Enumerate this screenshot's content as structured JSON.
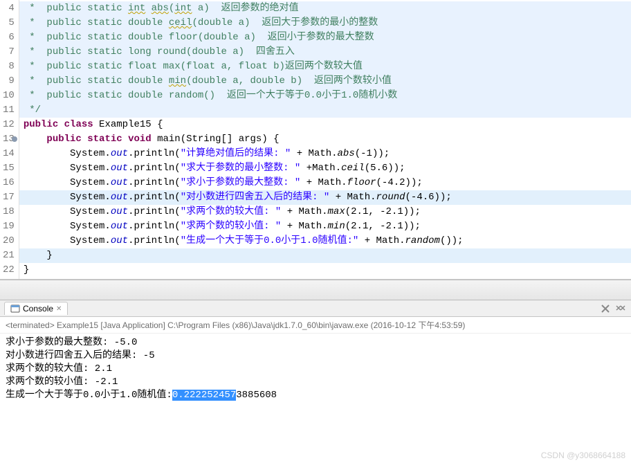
{
  "editor": {
    "lines": [
      {
        "num": "4",
        "bg": "comment-block",
        "seg": [
          {
            "t": " *  ",
            "c": "comment"
          },
          {
            "t": "public static ",
            "c": "comment"
          },
          {
            "t": "int",
            "c": "comment wavy"
          },
          {
            "t": " ",
            "c": "comment"
          },
          {
            "t": "abs",
            "c": "comment wavy"
          },
          {
            "t": "(",
            "c": "comment"
          },
          {
            "t": "int",
            "c": "comment wavy"
          },
          {
            "t": " a)  返回参数的绝对值",
            "c": "comment"
          }
        ]
      },
      {
        "num": "5",
        "bg": "comment-block",
        "seg": [
          {
            "t": " *  ",
            "c": "comment"
          },
          {
            "t": "public static double ",
            "c": "comment"
          },
          {
            "t": "ceil",
            "c": "comment wavy"
          },
          {
            "t": "(double a)  返回大于参数的最小的整数",
            "c": "comment"
          }
        ]
      },
      {
        "num": "6",
        "bg": "comment-block",
        "seg": [
          {
            "t": " *  public static double floor(double a)  返回小于参数的最大整数",
            "c": "comment"
          }
        ]
      },
      {
        "num": "7",
        "bg": "comment-block",
        "seg": [
          {
            "t": " *  public static long round(double a)  四舍五入",
            "c": "comment"
          }
        ]
      },
      {
        "num": "8",
        "bg": "comment-block",
        "seg": [
          {
            "t": " *  public static float max(float a, float b)返回两个数较大值",
            "c": "comment"
          }
        ]
      },
      {
        "num": "9",
        "bg": "comment-block",
        "seg": [
          {
            "t": " *  public static double ",
            "c": "comment"
          },
          {
            "t": "min",
            "c": "comment wavy"
          },
          {
            "t": "(double a, double b)  返回两个数较小值",
            "c": "comment"
          }
        ]
      },
      {
        "num": "10",
        "bg": "comment-block",
        "seg": [
          {
            "t": " *  public static double random()  返回一个大于等于0.0小于1.0随机小数",
            "c": "comment"
          }
        ]
      },
      {
        "num": "11",
        "bg": "comment-block",
        "seg": [
          {
            "t": " */",
            "c": "comment"
          }
        ]
      },
      {
        "num": "12",
        "bg": "",
        "seg": [
          {
            "t": "public",
            "c": "kw"
          },
          {
            "t": " ",
            "c": ""
          },
          {
            "t": "class",
            "c": "kw"
          },
          {
            "t": " Example15 {",
            "c": ""
          }
        ]
      },
      {
        "num": "13",
        "bg": "",
        "marker": true,
        "seg": [
          {
            "t": "    ",
            "c": ""
          },
          {
            "t": "public",
            "c": "kw"
          },
          {
            "t": " ",
            "c": ""
          },
          {
            "t": "static",
            "c": "kw"
          },
          {
            "t": " ",
            "c": ""
          },
          {
            "t": "void",
            "c": "kw"
          },
          {
            "t": " main(String[] args) {",
            "c": ""
          }
        ]
      },
      {
        "num": "14",
        "bg": "",
        "seg": [
          {
            "t": "        System.",
            "c": ""
          },
          {
            "t": "out",
            "c": "field"
          },
          {
            "t": ".println(",
            "c": ""
          },
          {
            "t": "\"计算绝对值后的结果: \"",
            "c": "str"
          },
          {
            "t": " + Math.",
            "c": ""
          },
          {
            "t": "abs",
            "c": "method-italic"
          },
          {
            "t": "(-1));",
            "c": ""
          }
        ]
      },
      {
        "num": "15",
        "bg": "",
        "seg": [
          {
            "t": "        System.",
            "c": ""
          },
          {
            "t": "out",
            "c": "field"
          },
          {
            "t": ".println(",
            "c": ""
          },
          {
            "t": "\"求大于参数的最小整数: \"",
            "c": "str"
          },
          {
            "t": " +Math.",
            "c": ""
          },
          {
            "t": "ceil",
            "c": "method-italic"
          },
          {
            "t": "(5.6));",
            "c": ""
          }
        ]
      },
      {
        "num": "16",
        "bg": "",
        "seg": [
          {
            "t": "        System.",
            "c": ""
          },
          {
            "t": "out",
            "c": "field"
          },
          {
            "t": ".println(",
            "c": ""
          },
          {
            "t": "\"求小于参数的最大整数: \"",
            "c": "str"
          },
          {
            "t": " + Math.",
            "c": ""
          },
          {
            "t": "floor",
            "c": "method-italic"
          },
          {
            "t": "(-4.2));",
            "c": ""
          }
        ]
      },
      {
        "num": "17",
        "bg": "hl",
        "seg": [
          {
            "t": "        System.",
            "c": ""
          },
          {
            "t": "out",
            "c": "field"
          },
          {
            "t": ".println(",
            "c": ""
          },
          {
            "t": "\"对小数进行四舍五入后的结果: \"",
            "c": "str"
          },
          {
            "t": " + Math.",
            "c": ""
          },
          {
            "t": "round",
            "c": "method-italic"
          },
          {
            "t": "(-4.6));",
            "c": ""
          }
        ]
      },
      {
        "num": "18",
        "bg": "",
        "seg": [
          {
            "t": "        System.",
            "c": ""
          },
          {
            "t": "out",
            "c": "field"
          },
          {
            "t": ".println(",
            "c": ""
          },
          {
            "t": "\"求两个数的较大值: \"",
            "c": "str"
          },
          {
            "t": " + Math.",
            "c": ""
          },
          {
            "t": "max",
            "c": "method-italic"
          },
          {
            "t": "(2.1, -2.1));",
            "c": ""
          }
        ]
      },
      {
        "num": "19",
        "bg": "",
        "seg": [
          {
            "t": "        System.",
            "c": ""
          },
          {
            "t": "out",
            "c": "field"
          },
          {
            "t": ".println(",
            "c": ""
          },
          {
            "t": "\"求两个数的较小值: \"",
            "c": "str"
          },
          {
            "t": " + Math.",
            "c": ""
          },
          {
            "t": "min",
            "c": "method-italic"
          },
          {
            "t": "(2.1, -2.1));",
            "c": ""
          }
        ]
      },
      {
        "num": "20",
        "bg": "",
        "seg": [
          {
            "t": "        System.",
            "c": ""
          },
          {
            "t": "out",
            "c": "field"
          },
          {
            "t": ".println(",
            "c": ""
          },
          {
            "t": "\"生成一个大于等于0.0小于1.0随机值:\"",
            "c": "str"
          },
          {
            "t": " + Math.",
            "c": ""
          },
          {
            "t": "random",
            "c": "method-italic"
          },
          {
            "t": "());",
            "c": ""
          }
        ]
      },
      {
        "num": "21",
        "bg": "hl",
        "seg": [
          {
            "t": "    }",
            "c": ""
          }
        ]
      },
      {
        "num": "22",
        "bg": "",
        "seg": [
          {
            "t": "}",
            "c": ""
          }
        ]
      }
    ]
  },
  "console": {
    "tab_label": "Console",
    "header": "<terminated> Example15 [Java Application] C:\\Program Files (x86)\\Java\\jdk1.7.0_60\\bin\\javaw.exe (2016-10-12 下午4:53:59)",
    "output": [
      {
        "seg": [
          {
            "t": "求小于参数的最大整数: -5.0"
          }
        ]
      },
      {
        "seg": [
          {
            "t": "对小数进行四舍五入后的结果: -5"
          }
        ]
      },
      {
        "seg": [
          {
            "t": "求两个数的较大值: 2.1"
          }
        ]
      },
      {
        "seg": [
          {
            "t": "求两个数的较小值: -2.1"
          }
        ]
      },
      {
        "seg": [
          {
            "t": "生成一个大于等于0.0小于1.0随机值:"
          },
          {
            "t": "0.222252457",
            "sel": true
          },
          {
            "t": "3885608"
          }
        ]
      }
    ]
  },
  "watermark": "CSDN @y3068664188"
}
